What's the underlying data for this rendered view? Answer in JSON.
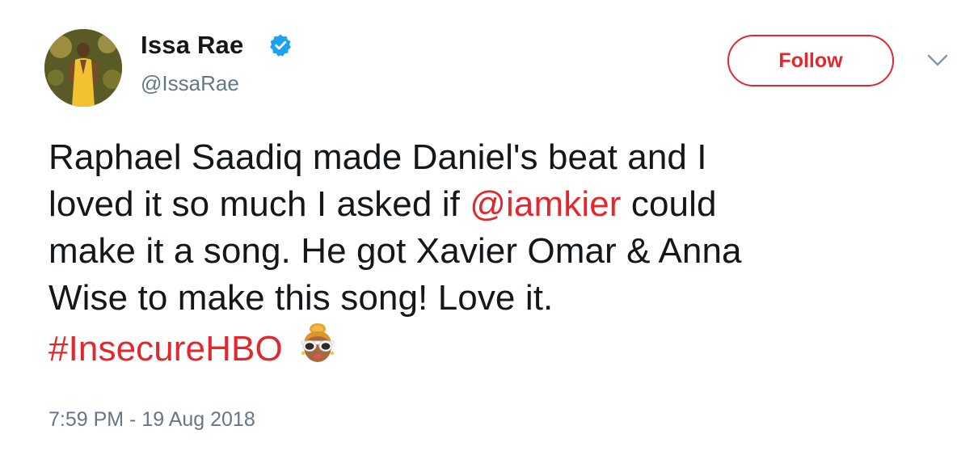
{
  "user": {
    "display_name": "Issa Rae",
    "handle": "@IssaRae",
    "verified": true,
    "avatar_icon": "profile-photo"
  },
  "actions": {
    "follow_label": "Follow",
    "more_icon": "chevron-down-icon"
  },
  "tweet": {
    "line1": "Raphael Saadiq made Daniel's beat and I",
    "line2_prefix": "loved it so much I asked if ",
    "mention": "@iamkier",
    "line2_suffix": " could",
    "line3": "make it a song. He got Xavier Omar & Anna",
    "line4": "Wise to make this song! Love it.",
    "hashtag": "#InsecureHBO",
    "emoji_icon": "woman-with-sunglasses-emoji",
    "timestamp": "7:59 PM - 19 Aug 2018"
  },
  "colors": {
    "accent": "#e0282e",
    "verified_blue": "#1da1f2",
    "secondary_text": "#657786",
    "primary_text": "#14171a"
  }
}
